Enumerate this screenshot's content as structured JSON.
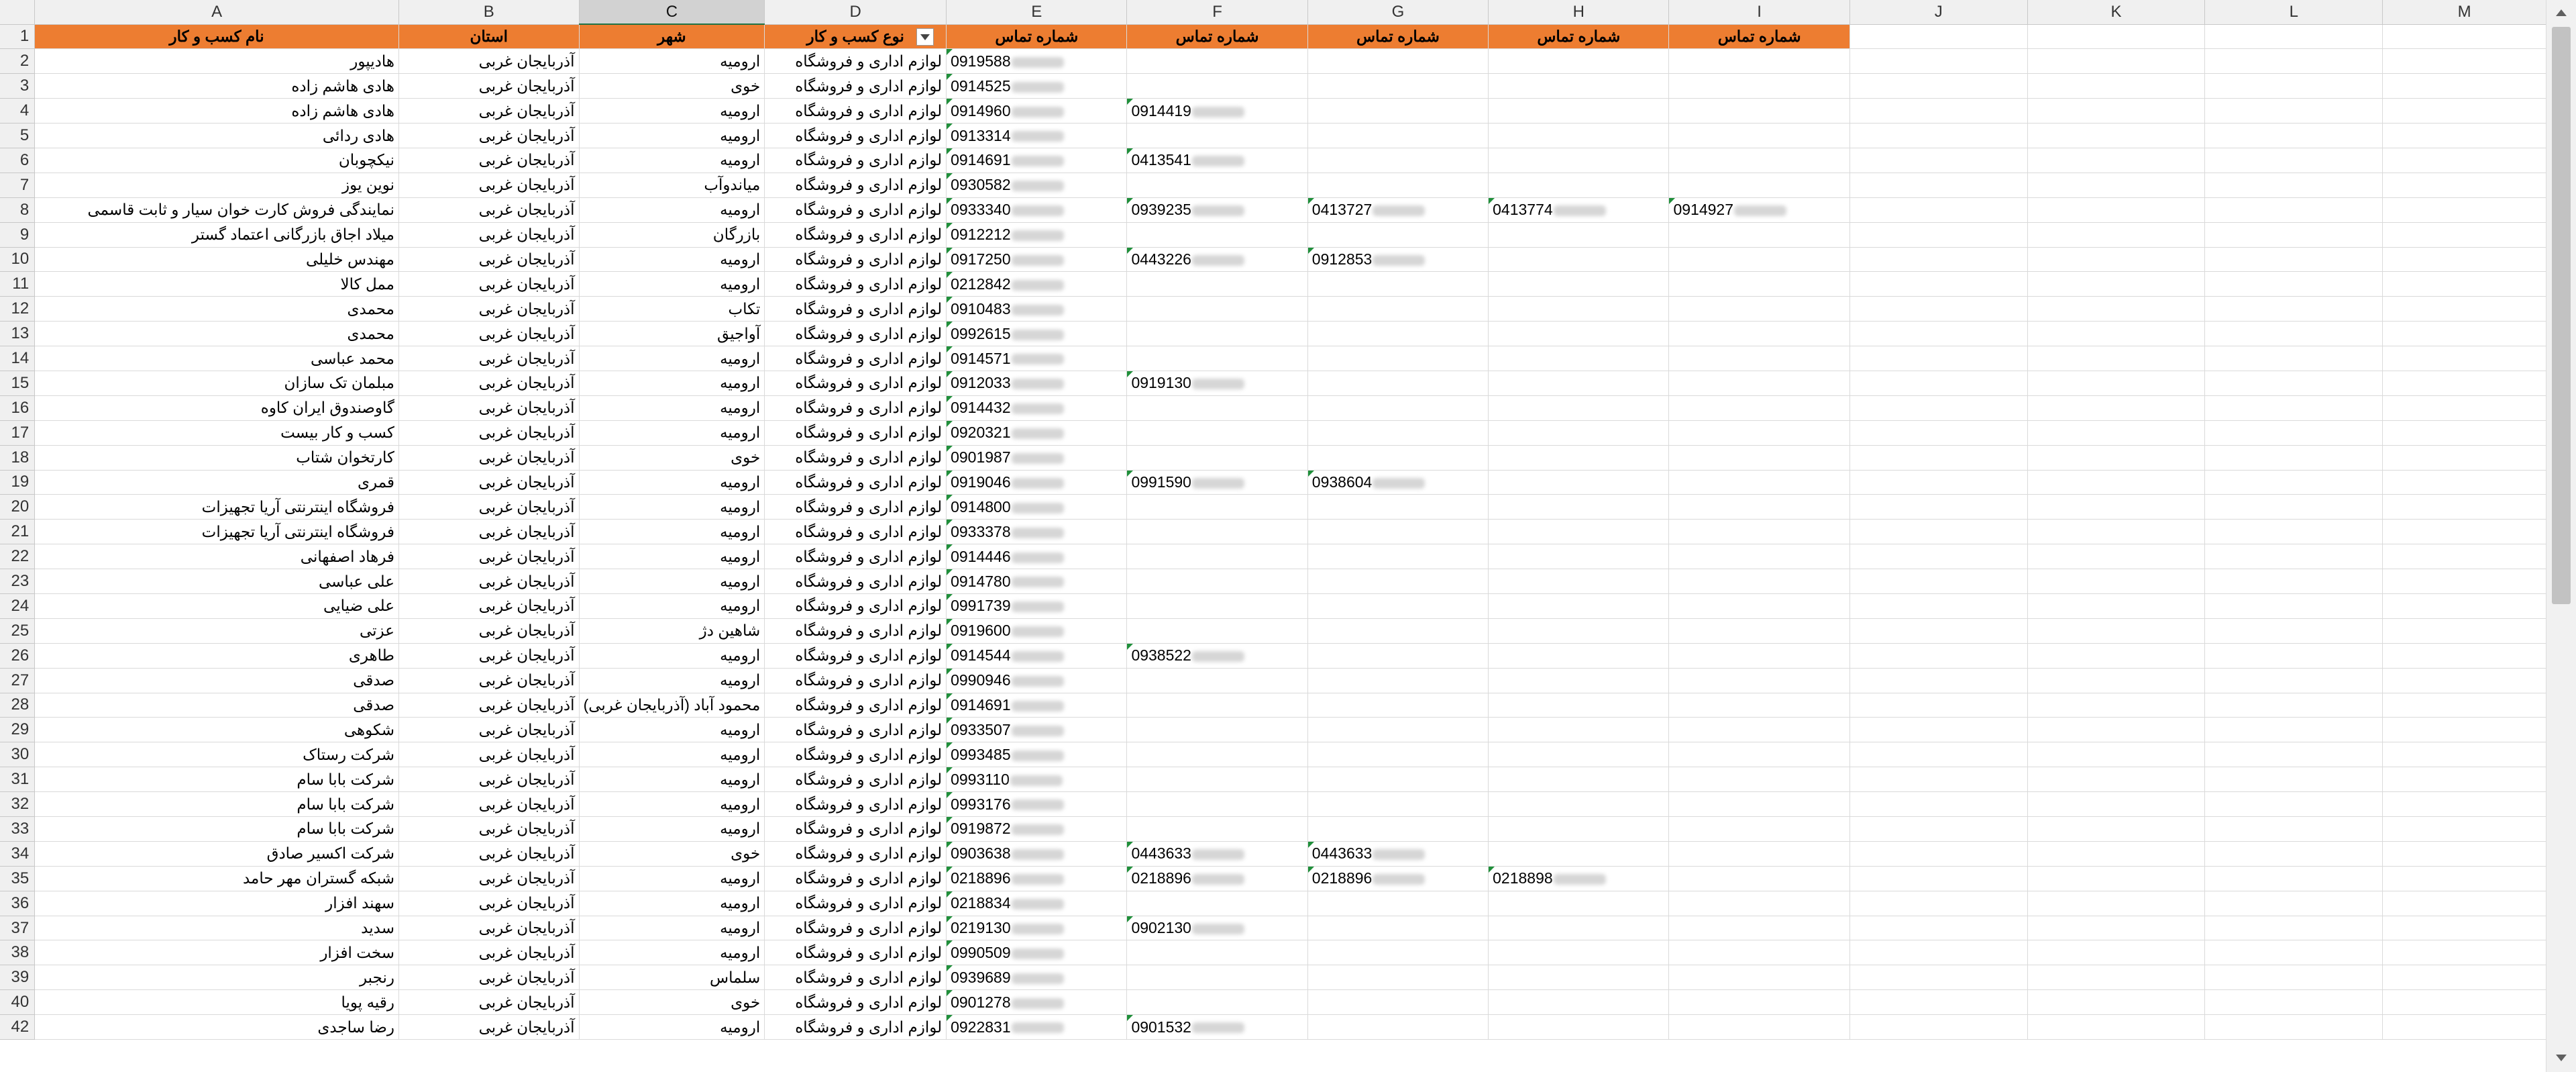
{
  "columns": [
    "A",
    "B",
    "C",
    "D",
    "E",
    "F",
    "G",
    "H",
    "I",
    "J",
    "K",
    "L",
    "M"
  ],
  "selected_column": "C",
  "header_row": {
    "number": "1",
    "cells": [
      "نام کسب و کار",
      "استان",
      "شهر",
      "نوع کسب و کار",
      "شماره تماس",
      "شماره تماس",
      "شماره تماس",
      "شماره تماس",
      "شماره تماس"
    ]
  },
  "rows": [
    {
      "n": "2",
      "name": "هادیپور",
      "prov": "آذربایجان غربی",
      "city": "ارومیه",
      "type": "لوازم اداری و فروشگاه",
      "phones": [
        "0919588"
      ]
    },
    {
      "n": "3",
      "name": "هادی هاشم زاده",
      "prov": "آذربایجان غربی",
      "city": "خوی",
      "type": "لوازم اداری و فروشگاه",
      "phones": [
        "0914525"
      ]
    },
    {
      "n": "4",
      "name": "هادی هاشم زاده",
      "prov": "آذربایجان غربی",
      "city": "ارومیه",
      "type": "لوازم اداری و فروشگاه",
      "phones": [
        "0914960",
        "0914419"
      ]
    },
    {
      "n": "5",
      "name": "هادی ردائی",
      "prov": "آذربایجان غربی",
      "city": "ارومیه",
      "type": "لوازم اداری و فروشگاه",
      "phones": [
        "0913314"
      ]
    },
    {
      "n": "6",
      "name": "نیکچوبان",
      "prov": "آذربایجان غربی",
      "city": "ارومیه",
      "type": "لوازم اداری و فروشگاه",
      "phones": [
        "0914691",
        "0413541"
      ]
    },
    {
      "n": "7",
      "name": "نوین یوز",
      "prov": "آذربایجان غربی",
      "city": "میاندوآب",
      "type": "لوازم اداری و فروشگاه",
      "phones": [
        "0930582"
      ]
    },
    {
      "n": "8",
      "name": "نمایندگی فروش کارت خوان سیار و ثابت قاسمی",
      "prov": "آذربایجان غربی",
      "city": "ارومیه",
      "type": "لوازم اداری و فروشگاه",
      "phones": [
        "0933340",
        "0939235",
        "0413727",
        "0413774",
        "0914927"
      ]
    },
    {
      "n": "9",
      "name": "میلاد اجاق بازرگانی اعتماد گستر",
      "prov": "آذربایجان غربی",
      "city": "بازرگان",
      "type": "لوازم اداری و فروشگاه",
      "phones": [
        "0912212"
      ]
    },
    {
      "n": "10",
      "name": "مهندس خلیلی",
      "prov": "آذربایجان غربی",
      "city": "ارومیه",
      "type": "لوازم اداری و فروشگاه",
      "phones": [
        "0917250",
        "0443226",
        "0912853"
      ]
    },
    {
      "n": "11",
      "name": "ممل کالا",
      "prov": "آذربایجان غربی",
      "city": "ارومیه",
      "type": "لوازم اداری و فروشگاه",
      "phones": [
        "0212842"
      ]
    },
    {
      "n": "12",
      "name": "محمدی",
      "prov": "آذربایجان غربی",
      "city": "تکاب",
      "type": "لوازم اداری و فروشگاه",
      "phones": [
        "0910483"
      ]
    },
    {
      "n": "13",
      "name": "محمدی",
      "prov": "آذربایجان غربی",
      "city": "آواجیق",
      "type": "لوازم اداری و فروشگاه",
      "phones": [
        "0992615"
      ]
    },
    {
      "n": "14",
      "name": "محمد عباسی",
      "prov": "آذربایجان غربی",
      "city": "ارومیه",
      "type": "لوازم اداری و فروشگاه",
      "phones": [
        "0914571"
      ]
    },
    {
      "n": "15",
      "name": "مبلمان تک سازان",
      "prov": "آذربایجان غربی",
      "city": "ارومیه",
      "type": "لوازم اداری و فروشگاه",
      "phones": [
        "0912033",
        "0919130"
      ]
    },
    {
      "n": "16",
      "name": "گاوصندوق  ایران کاوه",
      "prov": "آذربایجان غربی",
      "city": "ارومیه",
      "type": "لوازم اداری و فروشگاه",
      "phones": [
        "0914432"
      ]
    },
    {
      "n": "17",
      "name": "کسب و کار بیست",
      "prov": "آذربایجان غربی",
      "city": "ارومیه",
      "type": "لوازم اداری و فروشگاه",
      "phones": [
        "0920321"
      ]
    },
    {
      "n": "18",
      "name": "کارتخوان شتاب",
      "prov": "آذربایجان غربی",
      "city": "خوی",
      "type": "لوازم اداری و فروشگاه",
      "phones": [
        "0901987"
      ]
    },
    {
      "n": "19",
      "name": "قمری",
      "prov": "آذربایجان غربی",
      "city": "ارومیه",
      "type": "لوازم اداری و فروشگاه",
      "phones": [
        "0919046",
        "0991590",
        "0938604"
      ]
    },
    {
      "n": "20",
      "name": "فروشگاه اینترنتی آریا تجهیزات",
      "prov": "آذربایجان غربی",
      "city": "ارومیه",
      "type": "لوازم اداری و فروشگاه",
      "phones": [
        "0914800"
      ]
    },
    {
      "n": "21",
      "name": "فروشگاه اینترنتی آریا تجهیزات",
      "prov": "آذربایجان غربی",
      "city": "ارومیه",
      "type": "لوازم اداری و فروشگاه",
      "phones": [
        "0933378"
      ]
    },
    {
      "n": "22",
      "name": "فرهاد اصفهانی",
      "prov": "آذربایجان غربی",
      "city": "ارومیه",
      "type": "لوازم اداری و فروشگاه",
      "phones": [
        "0914446"
      ]
    },
    {
      "n": "23",
      "name": "علی عباسی",
      "prov": "آذربایجان غربی",
      "city": "ارومیه",
      "type": "لوازم اداری و فروشگاه",
      "phones": [
        "0914780"
      ]
    },
    {
      "n": "24",
      "name": "علی ضیایی",
      "prov": "آذربایجان غربی",
      "city": "ارومیه",
      "type": "لوازم اداری و فروشگاه",
      "phones": [
        "0991739"
      ]
    },
    {
      "n": "25",
      "name": "عزتی",
      "prov": "آذربایجان غربی",
      "city": "شاهین دژ",
      "type": "لوازم اداری و فروشگاه",
      "phones": [
        "0919600"
      ]
    },
    {
      "n": "26",
      "name": "طاهری",
      "prov": "آذربایجان غربی",
      "city": "ارومیه",
      "type": "لوازم اداری و فروشگاه",
      "phones": [
        "0914544",
        "0938522"
      ]
    },
    {
      "n": "27",
      "name": "صدقی",
      "prov": "آذربایجان غربی",
      "city": "ارومیه",
      "type": "لوازم اداری و فروشگاه",
      "phones": [
        "0990946"
      ]
    },
    {
      "n": "28",
      "name": "صدقی",
      "prov": "آذربایجان غربی",
      "city": "محمود آباد (آذربایجان غربی)",
      "type": "لوازم اداری و فروشگاه",
      "phones": [
        "0914691"
      ]
    },
    {
      "n": "29",
      "name": "شکوهی",
      "prov": "آذربایجان غربی",
      "city": "ارومیه",
      "type": "لوازم اداری و فروشگاه",
      "phones": [
        "0933507"
      ]
    },
    {
      "n": "30",
      "name": "شرکت رستاک",
      "prov": "آذربایجان غربی",
      "city": "ارومیه",
      "type": "لوازم اداری و فروشگاه",
      "phones": [
        "0993485"
      ]
    },
    {
      "n": "31",
      "name": "شرکت بابا سام",
      "prov": "آذربایجان غربی",
      "city": "ارومیه",
      "type": "لوازم اداری و فروشگاه",
      "phones": [
        "0993110"
      ]
    },
    {
      "n": "32",
      "name": "شرکت بابا سام",
      "prov": "آذربایجان غربی",
      "city": "ارومیه",
      "type": "لوازم اداری و فروشگاه",
      "phones": [
        "0993176"
      ]
    },
    {
      "n": "33",
      "name": "شرکت بابا سام",
      "prov": "آذربایجان غربی",
      "city": "ارومیه",
      "type": "لوازم اداری و فروشگاه",
      "phones": [
        "0919872"
      ]
    },
    {
      "n": "34",
      "name": "شرکت اکسیر صادق",
      "prov": "آذربایجان غربی",
      "city": "خوی",
      "type": "لوازم اداری و فروشگاه",
      "phones": [
        "0903638",
        "0443633",
        "0443633"
      ]
    },
    {
      "n": "35",
      "name": "شبکه گستران مهر حامد",
      "prov": "آذربایجان غربی",
      "city": "ارومیه",
      "type": "لوازم اداری و فروشگاه",
      "phones": [
        "0218896",
        "0218896",
        "0218896",
        "0218898"
      ]
    },
    {
      "n": "36",
      "name": "سهند افزار",
      "prov": "آذربایجان غربی",
      "city": "ارومیه",
      "type": "لوازم اداری و فروشگاه",
      "phones": [
        "0218834"
      ]
    },
    {
      "n": "37",
      "name": "سدید",
      "prov": "آذربایجان غربی",
      "city": "ارومیه",
      "type": "لوازم اداری و فروشگاه",
      "phones": [
        "0219130",
        "0902130"
      ]
    },
    {
      "n": "38",
      "name": "سخت افزار",
      "prov": "آذربایجان غربی",
      "city": "ارومیه",
      "type": "لوازم اداری و فروشگاه",
      "phones": [
        "0990509"
      ]
    },
    {
      "n": "39",
      "name": "رنجبر",
      "prov": "آذربایجان غربی",
      "city": "سلماس",
      "type": "لوازم اداری و فروشگاه",
      "phones": [
        "0939689"
      ]
    },
    {
      "n": "40",
      "name": "رقیه پویا",
      "prov": "آذربایجان غربی",
      "city": "خوی",
      "type": "لوازم اداری و فروشگاه",
      "phones": [
        "0901278"
      ]
    },
    {
      "n": "42",
      "name": "رضا ساجدی",
      "prov": "آذربایجان غربی",
      "city": "ارومیه",
      "type": "لوازم اداری و فروشگاه",
      "phones": [
        "0922831",
        "0901532"
      ]
    }
  ],
  "colors": {
    "header_fill": "#ed7d31",
    "header_text": "#ffffff",
    "gridline": "#dadada",
    "comment_marker": "#1f8f3a",
    "selection": "#217346"
  }
}
